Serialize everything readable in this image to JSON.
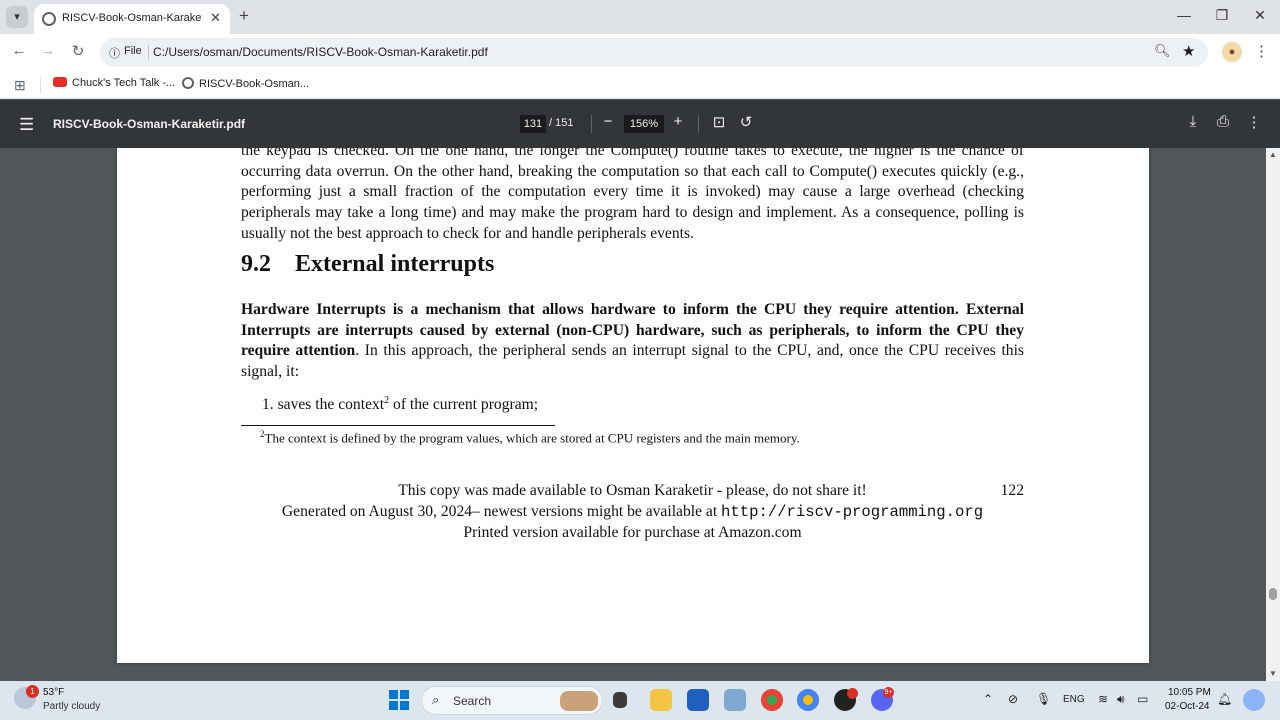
{
  "browser": {
    "tab_title": "RISCV-Book-Osman-Karaketir.p",
    "tab_close": "✕",
    "new_tab": "+",
    "address_scheme_label": "File",
    "address_url": "C:/Users/osman/Documents/RISCV-Book-Osman-Karaketir.pdf",
    "bookmarks": [
      "Chuck's Tech Talk -...",
      "RISCV-Book-Osman..."
    ]
  },
  "pdf_toolbar": {
    "file_name": "RISCV-Book-Osman-Karaketir.pdf",
    "current_page": "131",
    "page_total": "/ 151",
    "zoom": "156%",
    "zoom_out": "−",
    "zoom_in": "+"
  },
  "document": {
    "para1": "the keypad is checked. On the one hand, the longer the Compute() routine takes to execute, the higher is the chance of occurring data overrun. On the other hand, breaking the computation so that each call to Compute() executes quickly (e.g., performing just a small fraction of the computation every time it is invoked) may cause a large overhead (checking peripherals may take a long time) and may make the program hard to design and implement. As a consequence, polling is usually not the best approach to check for and handle peripherals events.",
    "section_number": "9.2",
    "section_title": "External interrupts",
    "para2_bold": "Hardware Interrupts is a mechanism that allows hardware to inform the CPU they require attention. External Interrupts are interrupts caused by external (non-CPU) hardware, such as peripherals, to inform the CPU they require attention",
    "para2_rest": ". In this approach, the peripheral sends an interrupt signal to the CPU, and, once the CPU receives this signal, it:",
    "list_item_1": "1.  saves the context",
    "list_item_1_sup": "2",
    "list_item_1_end": " of the current program;",
    "footnote_mark": "2",
    "footnote_text": "The context is defined by the program values, which are stored at CPU registers and the main memory.",
    "footer_line1": "This copy was made available to Osman Karaketir - please, do not share it!",
    "footer_page": "122",
    "footer_line2_a": "Generated on August 30, 2024– newest versions might be available at ",
    "footer_line2_url": "http://riscv-programming.org",
    "footer_line3": "Printed version available for purchase at Amazon.com"
  },
  "taskbar": {
    "weather_badge": "1",
    "weather_temp": "53°F",
    "weather_desc": "Partly cloudy",
    "search_label": "Search",
    "discord_badge": "9+",
    "language": "ENG",
    "time": "10:05 PM",
    "date": "02-Oct-24"
  },
  "colors": {
    "pdf_toolbar_bg": "#323639",
    "viewer_bg": "#525659",
    "youtube_red": "#e52d27",
    "windows_blue": "#0078d4"
  }
}
